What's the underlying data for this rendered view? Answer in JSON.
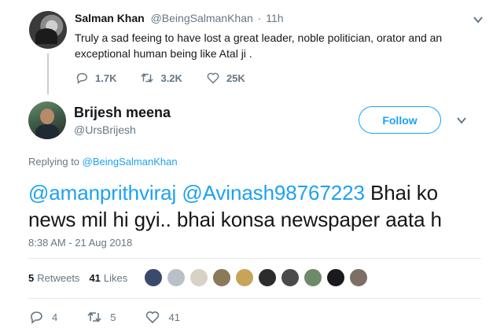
{
  "parent_tweet": {
    "name": "Salman Khan",
    "handle": "@BeingSalmanKhan",
    "separator": "·",
    "time": "11h",
    "text": "Truly a sad feeing to have lost a great leader, noble politician, orator and an exceptional human being like Atal ji .",
    "replies": "1.7K",
    "retweets": "3.2K",
    "likes": "25K"
  },
  "tweet": {
    "name": "Brijesh meena",
    "handle": "@UrsBrijesh",
    "follow_label": "Follow",
    "replying_prefix": "Replying to",
    "replying_to": "@BeingSalmanKhan",
    "mention_1": "@amanprithviraj",
    "mention_2": "@Avinash98767223",
    "text_rest": "Bhai ko news mil hi gyi.. bhai konsa newspaper aata h",
    "timestamp": "8:38 AM - 21 Aug 2018",
    "retweet_count": "5",
    "retweet_label": "Retweets",
    "like_count": "41",
    "like_label": "Likes",
    "likers": [
      {
        "color": "#3b4a6b"
      },
      {
        "color": "#b9c0c8"
      },
      {
        "color": "#d9d2c4"
      },
      {
        "color": "#8a7a5a"
      },
      {
        "color": "#c8a45a"
      },
      {
        "color": "#2c2c2c"
      },
      {
        "color": "#4a4a4a"
      },
      {
        "color": "#6f8a6a"
      },
      {
        "color": "#1a1a1a"
      },
      {
        "color": "#7c6f66"
      }
    ],
    "replies": "4",
    "retweets": "5",
    "likes": "41"
  },
  "colors": {
    "accent": "#1da1f2",
    "muted": "#657786",
    "text": "#14171a",
    "divider": "#e6ecf0"
  }
}
